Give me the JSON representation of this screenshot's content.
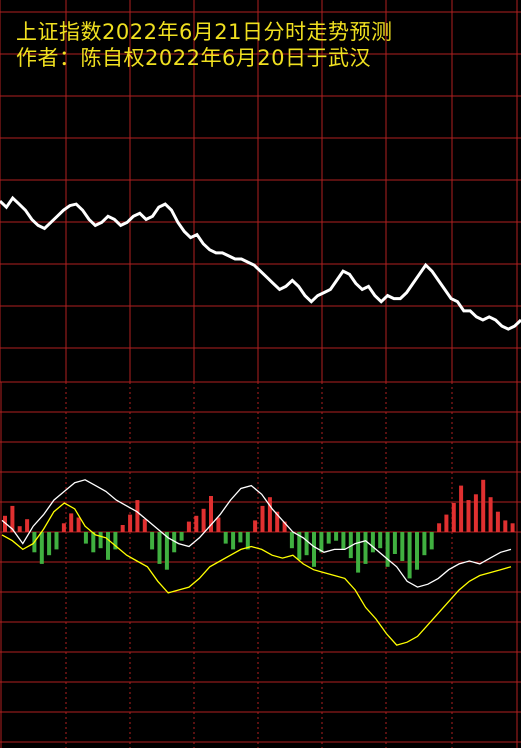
{
  "header": {
    "line1": "上证指数2022年6月21日分时走势预测",
    "line2": "作者：陈自权2022年6月20日于武汉"
  },
  "colors": {
    "background": "#000000",
    "grid": "#b02020",
    "price_line": "#ffffff",
    "avg_line": "#ffff00",
    "bar_up": "#e03030",
    "bar_down": "#40b040",
    "title": "#f0e020"
  },
  "chart_data": [
    {
      "type": "line",
      "panel": "top",
      "series": [
        {
          "values": [
            0.72,
            0.68,
            0.74,
            0.7,
            0.66,
            0.6,
            0.56,
            0.54,
            0.58,
            0.62,
            0.66,
            0.69,
            0.7,
            0.66,
            0.6,
            0.56,
            0.58,
            0.62,
            0.6,
            0.56,
            0.58,
            0.62,
            0.64,
            0.6,
            0.62,
            0.68,
            0.7,
            0.66,
            0.58,
            0.52,
            0.48,
            0.5,
            0.44,
            0.4,
            0.38,
            0.38,
            0.36,
            0.34,
            0.34,
            0.32,
            0.3,
            0.26,
            0.22,
            0.18,
            0.14,
            0.16,
            0.2,
            0.16,
            0.1,
            0.06,
            0.1,
            0.12,
            0.14,
            0.2,
            0.26,
            0.24,
            0.18,
            0.14,
            0.16,
            0.1,
            0.06,
            0.1,
            0.08,
            0.08,
            0.12,
            0.18,
            0.24,
            0.3,
            0.26,
            0.2,
            0.14,
            0.08,
            0.06,
            0.0,
            0.0,
            -0.04,
            -0.06,
            -0.04,
            -0.06,
            -0.1,
            -0.12,
            -0.1,
            -0.06
          ]
        }
      ],
      "grid": true
    },
    {
      "type": "bar",
      "panel": "bottom",
      "bars": [
        0.28,
        0.45,
        0.1,
        0.22,
        -0.35,
        -0.55,
        -0.4,
        -0.3,
        0.15,
        0.32,
        0.25,
        -0.2,
        -0.35,
        -0.28,
        -0.48,
        -0.3,
        0.12,
        0.3,
        0.55,
        0.22,
        -0.3,
        -0.55,
        -0.65,
        -0.35,
        -0.15,
        0.18,
        0.28,
        0.4,
        0.62,
        0.25,
        -0.2,
        -0.3,
        -0.18,
        -0.3,
        0.2,
        0.45,
        0.6,
        0.35,
        0.18,
        -0.28,
        -0.48,
        -0.4,
        -0.6,
        -0.35,
        -0.2,
        -0.15,
        -0.3,
        -0.45,
        -0.7,
        -0.55,
        -0.35,
        -0.28,
        -0.6,
        -0.38,
        -0.5,
        -0.8,
        -0.65,
        -0.4,
        -0.3,
        0.15,
        0.3,
        0.5,
        0.8,
        0.55,
        0.65,
        0.9,
        0.6,
        0.35,
        0.2,
        0.15
      ],
      "series": [
        {
          "values": [
            0.2,
            0.05,
            -0.2,
            0.1,
            0.3,
            0.55,
            0.7,
            0.85,
            0.9,
            0.8,
            0.7,
            0.55,
            0.45,
            0.35,
            0.2,
            0.05,
            -0.1,
            -0.2,
            -0.25,
            -0.1,
            0.1,
            0.3,
            0.55,
            0.75,
            0.8,
            0.65,
            0.4,
            0.2,
            0.0,
            -0.1,
            -0.25,
            -0.35,
            -0.3,
            -0.3,
            -0.2,
            -0.15,
            -0.3,
            -0.45,
            -0.6,
            -0.85,
            -0.95,
            -0.9,
            -0.8,
            -0.65,
            -0.55,
            -0.5,
            -0.55,
            -0.45,
            -0.35,
            -0.3
          ]
        },
        {
          "values": [
            -0.05,
            -0.15,
            -0.3,
            -0.2,
            0.05,
            0.35,
            0.5,
            0.4,
            0.1,
            -0.05,
            -0.1,
            -0.25,
            -0.4,
            -0.5,
            -0.6,
            -0.85,
            -1.05,
            -1.0,
            -0.95,
            -0.8,
            -0.6,
            -0.5,
            -0.4,
            -0.3,
            -0.25,
            -0.3,
            -0.4,
            -0.45,
            -0.4,
            -0.55,
            -0.65,
            -0.7,
            -0.75,
            -0.8,
            -1.0,
            -1.3,
            -1.5,
            -1.75,
            -1.95,
            -1.9,
            -1.8,
            -1.6,
            -1.4,
            -1.2,
            -1.0,
            -0.85,
            -0.75,
            -0.7,
            -0.65,
            -0.6
          ]
        }
      ],
      "grid": true
    }
  ]
}
